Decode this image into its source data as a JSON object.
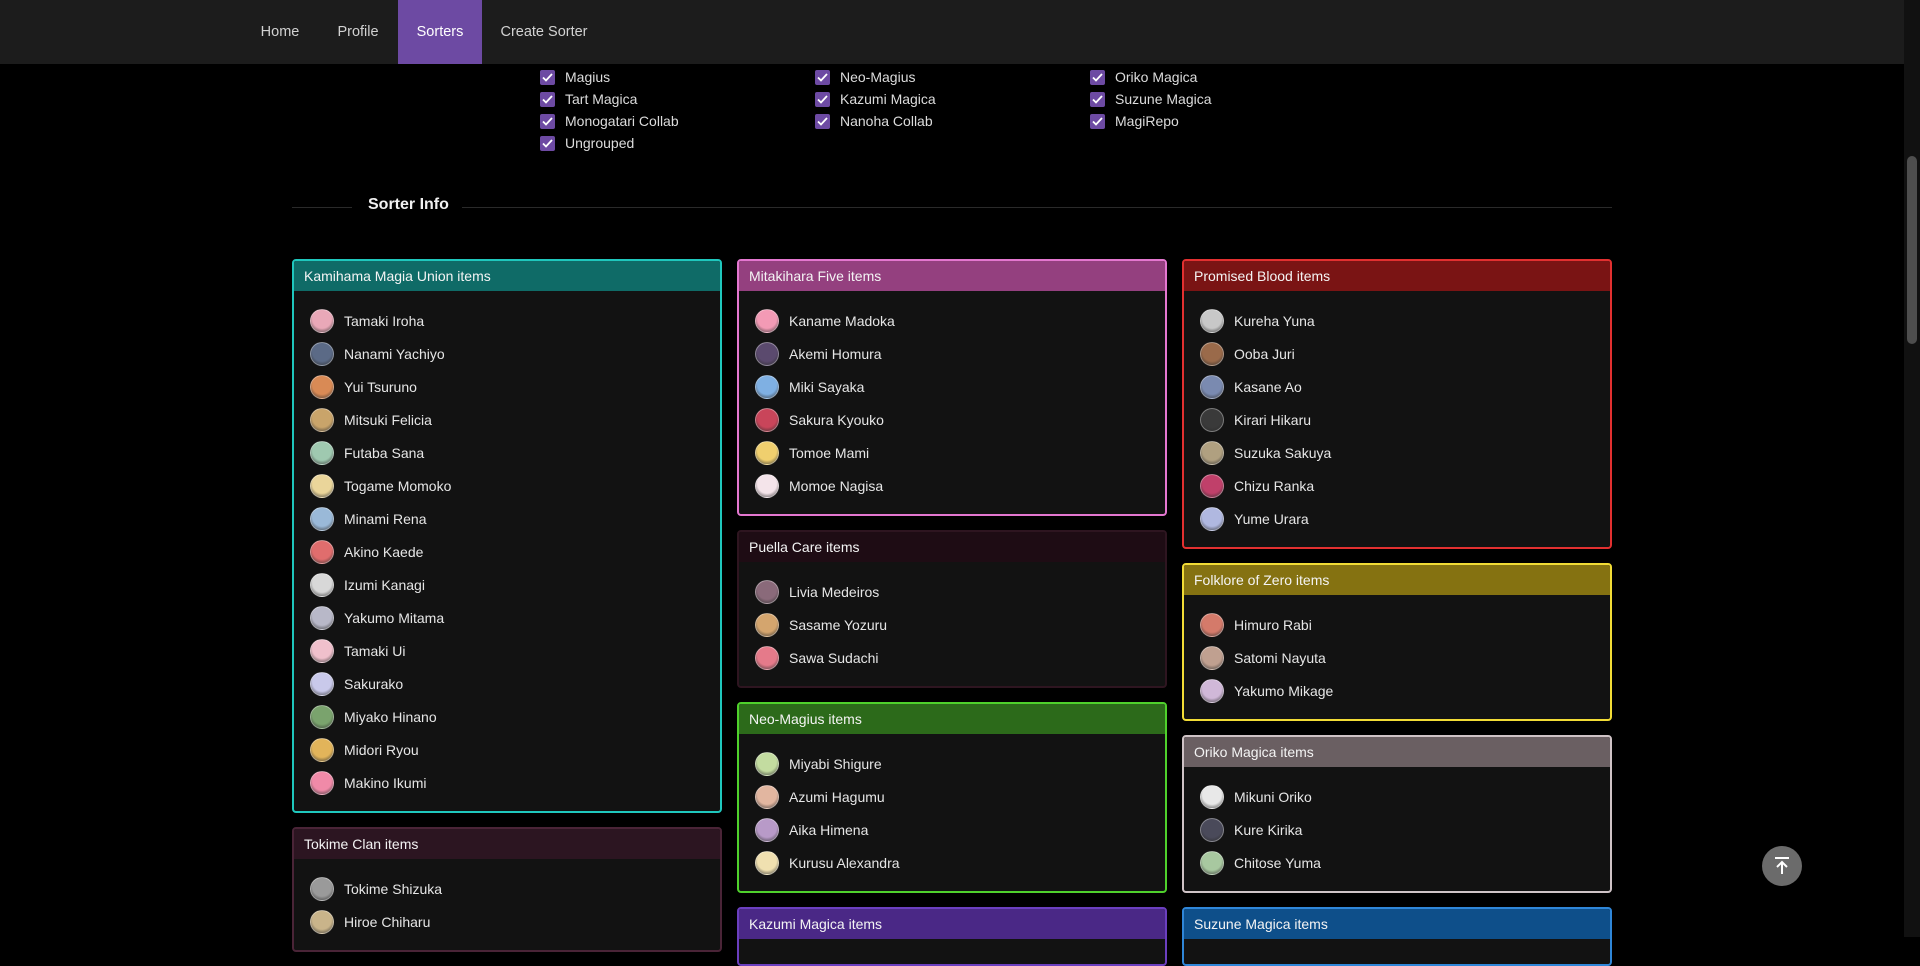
{
  "nav": {
    "items": [
      {
        "label": "Home",
        "active": false
      },
      {
        "label": "Profile",
        "active": false
      },
      {
        "label": "Sorters",
        "active": true
      },
      {
        "label": "Create Sorter",
        "active": false
      }
    ]
  },
  "groups_filter": {
    "columns": [
      [
        "Magius",
        "Tart Magica",
        "Monogatari Collab",
        "Ungrouped"
      ],
      [
        "Neo-Magius",
        "Kazumi Magica",
        "Nanoha Collab"
      ],
      [
        "Oriko Magica",
        "Suzune Magica",
        "MagiRepo"
      ]
    ],
    "checked_color": "#6d4aa3"
  },
  "sorter_info": {
    "title": "Sorter Info"
  },
  "colors": {
    "background": "#000000",
    "nav_bg": "#1c1c1c",
    "accent": "#6d4aa3"
  },
  "cards": [
    {
      "title": "Kamihama Magia Union items",
      "header_color": "#0f6b67",
      "border_color": "#1fc7bd",
      "members": [
        {
          "name": "Tamaki Iroha",
          "avatar_color": "#e9a8b8"
        },
        {
          "name": "Nanami Yachiyo",
          "avatar_color": "#5b6a86"
        },
        {
          "name": "Yui Tsuruno",
          "avatar_color": "#d98a55"
        },
        {
          "name": "Mitsuki Felicia",
          "avatar_color": "#c9a46a"
        },
        {
          "name": "Futaba Sana",
          "avatar_color": "#9fc9b0"
        },
        {
          "name": "Togame Momoko",
          "avatar_color": "#ead59a"
        },
        {
          "name": "Minami Rena",
          "avatar_color": "#9ab9d8"
        },
        {
          "name": "Akino Kaede",
          "avatar_color": "#e06d6d"
        },
        {
          "name": "Izumi Kanagi",
          "avatar_color": "#d8d8d8"
        },
        {
          "name": "Yakumo Mitama",
          "avatar_color": "#b8b8c8"
        },
        {
          "name": "Tamaki Ui",
          "avatar_color": "#f0c0cc"
        },
        {
          "name": "Sakurako",
          "avatar_color": "#c9c9ea"
        },
        {
          "name": "Miyako Hinano",
          "avatar_color": "#7aa36d"
        },
        {
          "name": "Midori Ryou",
          "avatar_color": "#e2b45a"
        },
        {
          "name": "Makino Ikumi",
          "avatar_color": "#f08aa8"
        }
      ]
    },
    {
      "title": "Tokime Clan items",
      "header_color": "#2c1521",
      "border_color": "#4a2437",
      "members": [
        {
          "name": "Tokime Shizuka",
          "avatar_color": "#9a9a9a"
        },
        {
          "name": "Hiroe Chiharu",
          "avatar_color": "#c9b48a"
        }
      ]
    },
    {
      "title": "Mitakihara Five items",
      "header_color": "#94407f",
      "border_color": "#e477d0",
      "members": [
        {
          "name": "Kaname Madoka",
          "avatar_color": "#f39ab5"
        },
        {
          "name": "Akemi Homura",
          "avatar_color": "#5b4a6e"
        },
        {
          "name": "Miki Sayaka",
          "avatar_color": "#7fb0e3"
        },
        {
          "name": "Sakura Kyouko",
          "avatar_color": "#c9455a"
        },
        {
          "name": "Tomoe Mami",
          "avatar_color": "#f0cf6e"
        },
        {
          "name": "Momoe Nagisa",
          "avatar_color": "#f4e4ea"
        }
      ]
    },
    {
      "title": "Puella Care items",
      "header_color": "#1e0c14",
      "border_color": "#2e1520",
      "members": [
        {
          "name": "Livia Medeiros",
          "avatar_color": "#8a6a7a"
        },
        {
          "name": "Sasame Yozuru",
          "avatar_color": "#d4a56e"
        },
        {
          "name": "Sawa Sudachi",
          "avatar_color": "#e57a8a"
        }
      ]
    },
    {
      "title": "Neo-Magius items",
      "header_color": "#2c6a1a",
      "border_color": "#4fd12c",
      "members": [
        {
          "name": "Miyabi Shigure",
          "avatar_color": "#c3dca0"
        },
        {
          "name": "Azumi Hagumu",
          "avatar_color": "#e2b6a0"
        },
        {
          "name": "Aika Himena",
          "avatar_color": "#b89ac8"
        },
        {
          "name": "Kurusu Alexandra",
          "avatar_color": "#f0e0b0"
        }
      ]
    },
    {
      "title": "Kazumi Magica items",
      "header_color": "#4a2886",
      "border_color": "#6b3fbf",
      "members": []
    },
    {
      "title": "Promised Blood items",
      "header_color": "#7a1414",
      "border_color": "#e23030",
      "members": [
        {
          "name": "Kureha Yuna",
          "avatar_color": "#c8c8c8"
        },
        {
          "name": "Ooba Juri",
          "avatar_color": "#9a6a4a"
        },
        {
          "name": "Kasane Ao",
          "avatar_color": "#7a8ab0"
        },
        {
          "name": "Kirari Hikaru",
          "avatar_color": "#3a3a3a"
        },
        {
          "name": "Suzuka Sakuya",
          "avatar_color": "#b0a080"
        },
        {
          "name": "Chizu Ranka",
          "avatar_color": "#c0406a"
        },
        {
          "name": "Yume Urara",
          "avatar_color": "#b0b8e0"
        }
      ]
    },
    {
      "title": "Folklore of Zero items",
      "header_color": "#857211",
      "border_color": "#f2dc36",
      "members": [
        {
          "name": "Himuro Rabi",
          "avatar_color": "#d47a6a"
        },
        {
          "name": "Satomi Nayuta",
          "avatar_color": "#c0a090"
        },
        {
          "name": "Yakumo Mikage",
          "avatar_color": "#d0b8d8"
        }
      ]
    },
    {
      "title": "Oriko Magica items",
      "header_color": "#6a5f62",
      "border_color": "#cfc3c6",
      "members": [
        {
          "name": "Mikuni Oriko",
          "avatar_color": "#e8e8e8"
        },
        {
          "name": "Kure Kirika",
          "avatar_color": "#4a4a5a"
        },
        {
          "name": "Chitose Yuma",
          "avatar_color": "#a8c8a0"
        }
      ]
    },
    {
      "title": "Suzune Magica items",
      "header_color": "#0e4f8a",
      "border_color": "#2f86d8",
      "members": []
    }
  ]
}
